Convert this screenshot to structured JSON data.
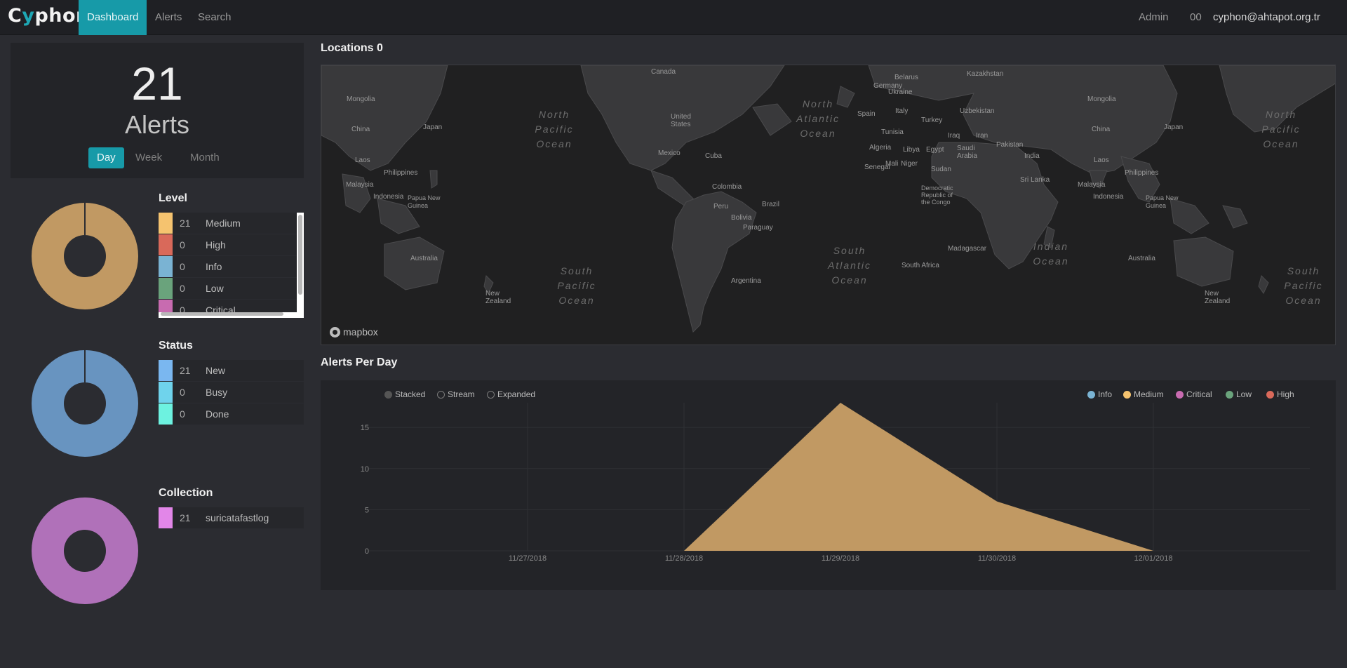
{
  "nav": {
    "brand_prefix": "C",
    "brand_accent": "y",
    "brand_suffix": "phon",
    "items": [
      {
        "label": "Dashboard",
        "active": true
      },
      {
        "label": "Alerts",
        "active": false
      },
      {
        "label": "Search",
        "active": false
      }
    ],
    "admin": "Admin",
    "notifications": "00",
    "user": "cyphon@ahtapot.org.tr"
  },
  "summary": {
    "count": "21",
    "label": "Alerts",
    "ranges": [
      "Day",
      "Week",
      "Month"
    ],
    "active_range": "Day"
  },
  "level": {
    "title": "Level",
    "rows": [
      {
        "count": "21",
        "name": "Medium",
        "color": "#f5c36f"
      },
      {
        "count": "0",
        "name": "High",
        "color": "#d9695a"
      },
      {
        "count": "0",
        "name": "Info",
        "color": "#7ab3d3"
      },
      {
        "count": "0",
        "name": "Low",
        "color": "#6aa37c"
      },
      {
        "count": "0",
        "name": "Critical",
        "color": "#c86bb0"
      }
    ]
  },
  "status": {
    "title": "Status",
    "rows": [
      {
        "count": "21",
        "name": "New",
        "color": "#7ab7f0"
      },
      {
        "count": "0",
        "name": "Busy",
        "color": "#6fd3ec"
      },
      {
        "count": "0",
        "name": "Done",
        "color": "#6df2e0"
      }
    ]
  },
  "collection": {
    "title": "Collection",
    "rows": [
      {
        "count": "21",
        "name": "suricatafastlog",
        "color": "#e286e8"
      }
    ]
  },
  "donut_colors": {
    "level": "#c19963",
    "status": "#6894c0",
    "collection": "#b071b9"
  },
  "map": {
    "title": "Locations 0",
    "attribution": "mapbox",
    "labels": [
      "Canada",
      "Belarus",
      "Ukraine",
      "Germany",
      "Kazakhstan",
      "Mongolia",
      "Mongolia",
      "Uzbekistan",
      "Spain",
      "Italy",
      "Turkey",
      "United States",
      "China",
      "China",
      "Japan",
      "Japan",
      "Tunisia",
      "Iraq",
      "Iran",
      "Algeria",
      "Libya",
      "Egypt",
      "Saudi Arabia",
      "Pakistan",
      "Mexico",
      "Cuba",
      "India",
      "Mali",
      "Niger",
      "Senegal",
      "Sudan",
      "Philippines",
      "Philippines",
      "Sri Lanka",
      "Malaysia",
      "Malaysia",
      "Laos",
      "Laos",
      "Colombia",
      "Indonesia",
      "Indonesia",
      "Brazil",
      "Democratic Republic of the Congo",
      "Papua New Guinea",
      "Papua New Guinea",
      "Peru",
      "Bolivia",
      "Paraguay",
      "Madagascar",
      "Australia",
      "Australia",
      "Argentina",
      "South Africa",
      "New Zealand",
      "New Zealand"
    ],
    "oceans": [
      "North Pacific Ocean",
      "North Atlantic Ocean",
      "North Pacific Ocean",
      "South Pacific Ocean",
      "South Atlantic Ocean",
      "Indian Ocean",
      "South Pacific Ocean"
    ]
  },
  "chart": {
    "title": "Alerts Per Day",
    "modes": [
      "Stacked",
      "Stream",
      "Expanded"
    ],
    "active_mode": "Stacked"
  },
  "chart_data": {
    "type": "area",
    "x": [
      "11/27/2018",
      "11/28/2018",
      "11/29/2018",
      "11/30/2018",
      "12/01/2018"
    ],
    "yticks": [
      0,
      5,
      10,
      15
    ],
    "ylim": [
      0,
      18
    ],
    "series": [
      {
        "name": "Info",
        "color": "#7ab3d3",
        "values": [
          0,
          0,
          0,
          0,
          0
        ]
      },
      {
        "name": "Medium",
        "color": "#f5c36f",
        "values": [
          0,
          0,
          18,
          6,
          0
        ]
      },
      {
        "name": "Critical",
        "color": "#c86bb0",
        "values": [
          0,
          0,
          0,
          0,
          0
        ]
      },
      {
        "name": "Low",
        "color": "#6aa37c",
        "values": [
          0,
          0,
          0,
          0,
          0
        ]
      },
      {
        "name": "High",
        "color": "#d9695a",
        "values": [
          0,
          0,
          0,
          0,
          0
        ]
      }
    ],
    "area_color": "#c19963"
  }
}
